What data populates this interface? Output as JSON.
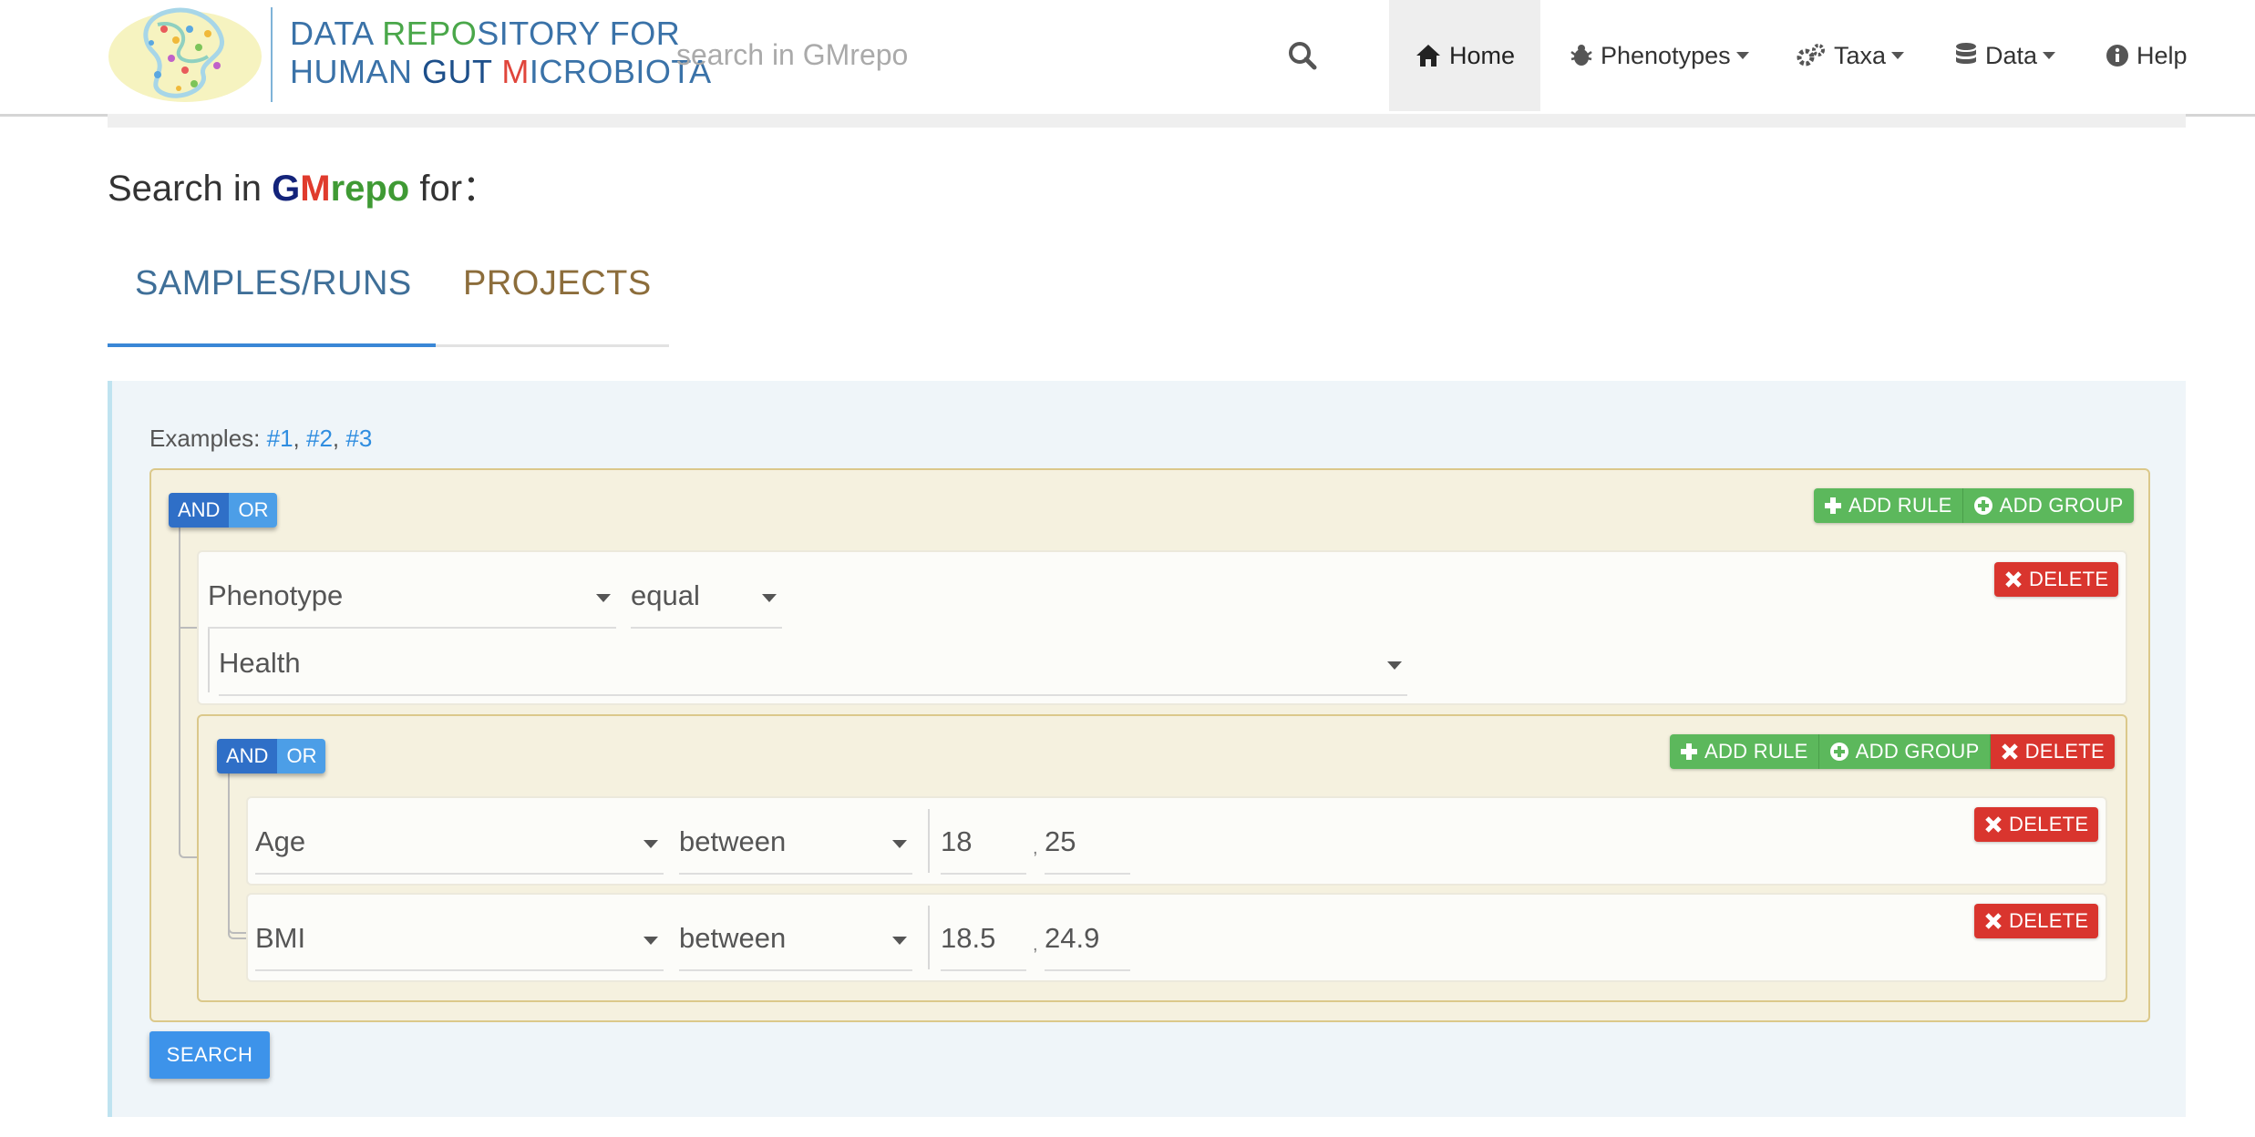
{
  "brand": {
    "line1_a": "DATA ",
    "line1_b": "REPO",
    "line1_c": "SITORY FOR",
    "line2_a": "HUMAN ",
    "line2_b": "GUT ",
    "line2_c": "M",
    "line2_d": "ICROBIOTA"
  },
  "search": {
    "placeholder": "search in GMrepo"
  },
  "nav": {
    "home": "Home",
    "phenotypes": "Phenotypes",
    "taxa": "Taxa",
    "data": "Data",
    "help": "Help",
    "active": "Home"
  },
  "heading": {
    "prefix": "Search in ",
    "gm_g": "G",
    "gm_m": "M",
    "gm_repo": "repo",
    "suffix": " for："
  },
  "tabs": {
    "samples": "SAMPLES/RUNS",
    "projects": "PROJECTS",
    "active": "SAMPLES/RUNS"
  },
  "examples": {
    "label": "Examples: ",
    "links": [
      "#1",
      "#2",
      "#3"
    ]
  },
  "builder": {
    "and_label": "AND",
    "or_label": "OR",
    "add_rule": "ADD RULE",
    "add_group": "ADD GROUP",
    "delete": "DELETE",
    "root_condition": "AND",
    "rule1": {
      "field": "Phenotype",
      "operator": "equal",
      "value": "Health"
    },
    "subgroup": {
      "condition": "AND",
      "rule_age": {
        "field": "Age",
        "operator": "between",
        "from": "18",
        "to": "25"
      },
      "rule_bmi": {
        "field": "BMI",
        "operator": "between",
        "from": "18.5",
        "to": "24.9"
      }
    }
  },
  "search_button": "SEARCH",
  "colors": {
    "accent_blue": "#3d93ea",
    "and_active": "#2f6fc7",
    "or_inactive": "#4c9ee7",
    "add_green": "#5cb85c",
    "delete_red": "#d9352e",
    "group_bg": "#f5f1df",
    "group_border": "#dbc88a",
    "panel_bg": "#eff5f9"
  },
  "icons": {
    "search": "search-icon",
    "home": "home-icon",
    "phenotypes": "bug-icon",
    "taxa": "cogs-icon",
    "data": "database-icon",
    "help": "info-circle-icon",
    "add_rule": "plus-icon",
    "add_group": "plus-circle-icon",
    "delete": "close-icon",
    "logo": "gut-microbiota-logo"
  }
}
